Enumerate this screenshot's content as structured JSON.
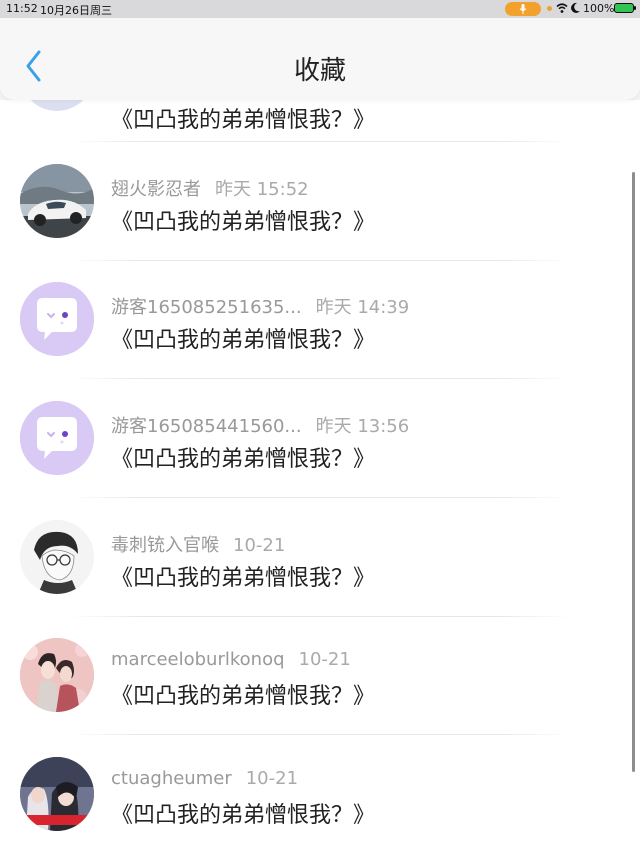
{
  "status_bar": {
    "time": "11:52",
    "date": "10月26日周三",
    "battery_percent": "100%",
    "icons": [
      "mic-icon",
      "wifi-icon",
      "moon-icon",
      "battery-icon"
    ],
    "accent_color": "#f2a22c",
    "battery_color": "#31c553"
  },
  "nav": {
    "title": "收藏",
    "back_icon": "chevron-left-icon",
    "back_color": "#3aa0e8"
  },
  "list": {
    "partial_top_item": {
      "text": "《凹凸我的弟弟憎恨我？》"
    },
    "items": [
      {
        "username": "翅火影忍者",
        "time": "昨天 15:52",
        "text": "《凹凸我的弟弟憎恨我？》",
        "avatar": "car-avatar"
      },
      {
        "username": "游客165085251635...",
        "time": "昨天 14:39",
        "text": "《凹凸我的弟弟憎恨我？》",
        "avatar": "default-purple-avatar"
      },
      {
        "username": "游客165085441560...",
        "time": "昨天 13:56",
        "text": "《凹凸我的弟弟憎恨我？》",
        "avatar": "default-purple-avatar"
      },
      {
        "username": "毒刺铳入官喉",
        "time": "10-21",
        "text": "《凹凸我的弟弟憎恨我？》",
        "avatar": "sketch-avatar"
      },
      {
        "username": "marceeloburlkonoq",
        "time": "10-21",
        "text": "《凹凸我的弟弟憎恨我？》",
        "avatar": "couple-avatar"
      },
      {
        "username": "ctuagheumer",
        "time": "10-21",
        "text": "《凹凸我的弟弟憎恨我？》",
        "avatar": "photo-avatar"
      }
    ]
  }
}
